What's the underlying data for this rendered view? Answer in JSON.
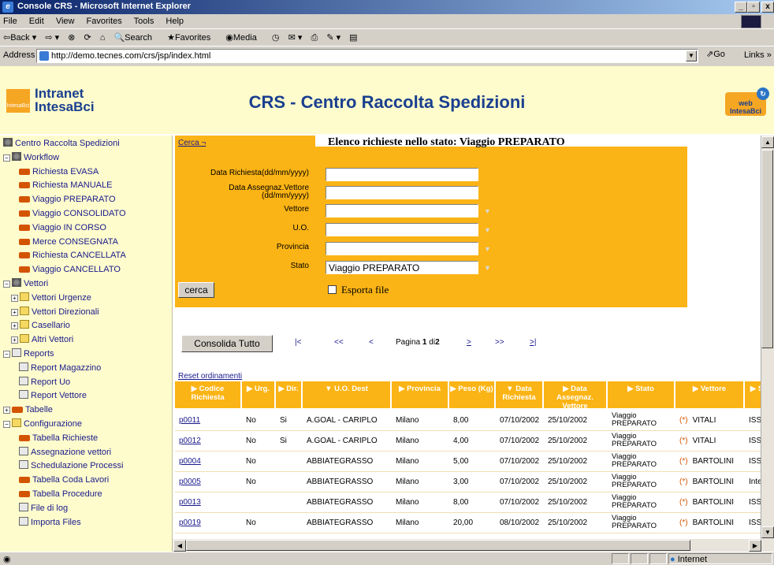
{
  "window": {
    "title": "Console CRS - Microsoft Internet Explorer"
  },
  "menu": [
    "File",
    "Edit",
    "View",
    "Favorites",
    "Tools",
    "Help"
  ],
  "toolbar": {
    "back": "⇦Back ▾",
    "forward": "⇨ ▾",
    "stop": "⊗",
    "refresh": "⟳",
    "home": "⌂",
    "search": "Search",
    "favorites": "Favorites",
    "media": "Media",
    "history": "◷",
    "mail": "✉ ▾",
    "print": "⎙",
    "edit": "✎ ▾",
    "discuss": "▤"
  },
  "address": {
    "label": "Address",
    "url": "http://demo.tecnes.com/crs/jsp/index.html",
    "go": "Go",
    "links": "Links"
  },
  "banner": {
    "logo_small": "IntesaBci",
    "logo_line1": "Intranet",
    "logo_line2": "IntesaBci",
    "title": "CRS - Centro Raccolta Spedizioni",
    "web_logo": "web IntesaBci"
  },
  "tree": [
    {
      "label": "Centro Raccolta Spedizioni",
      "indent": 0,
      "icon": "gear",
      "exp": ""
    },
    {
      "label": "Workflow",
      "indent": 0,
      "icon": "gear",
      "exp": "−"
    },
    {
      "label": "Richiesta EVASA",
      "indent": 2,
      "icon": "small",
      "exp": ""
    },
    {
      "label": "Richiesta MANUALE",
      "indent": 2,
      "icon": "small",
      "exp": ""
    },
    {
      "label": "Viaggio PREPARATO",
      "indent": 2,
      "icon": "small",
      "exp": ""
    },
    {
      "label": "Viaggio CONSOLIDATO",
      "indent": 2,
      "icon": "small",
      "exp": ""
    },
    {
      "label": "Viaggio IN CORSO",
      "indent": 2,
      "icon": "small",
      "exp": ""
    },
    {
      "label": "Merce CONSEGNATA",
      "indent": 2,
      "icon": "small",
      "exp": ""
    },
    {
      "label": "Richiesta CANCELLATA",
      "indent": 2,
      "icon": "small",
      "exp": ""
    },
    {
      "label": "Viaggio CANCELLATO",
      "indent": 2,
      "icon": "small",
      "exp": ""
    },
    {
      "label": "Vettori",
      "indent": 0,
      "icon": "gear",
      "exp": "−"
    },
    {
      "label": "Vettori Urgenze",
      "indent": 1,
      "icon": "folder",
      "exp": "+"
    },
    {
      "label": "Vettori Direzionali",
      "indent": 1,
      "icon": "folder",
      "exp": "+"
    },
    {
      "label": "Casellario",
      "indent": 1,
      "icon": "folder",
      "exp": "+"
    },
    {
      "label": "Altri Vettori",
      "indent": 1,
      "icon": "folder",
      "exp": "+"
    },
    {
      "label": "Reports",
      "indent": 0,
      "icon": "doc",
      "exp": "−"
    },
    {
      "label": "Report Magazzino",
      "indent": 2,
      "icon": "doc",
      "exp": ""
    },
    {
      "label": "Report Uo",
      "indent": 2,
      "icon": "doc",
      "exp": ""
    },
    {
      "label": "Report Vettore",
      "indent": 2,
      "icon": "doc",
      "exp": ""
    },
    {
      "label": "Tabelle",
      "indent": 0,
      "icon": "small",
      "exp": "+"
    },
    {
      "label": "Configurazione",
      "indent": 0,
      "icon": "folder",
      "exp": "−"
    },
    {
      "label": "Tabella Richieste",
      "indent": 2,
      "icon": "small",
      "exp": ""
    },
    {
      "label": "Assegnazione vettori",
      "indent": 2,
      "icon": "doc",
      "exp": ""
    },
    {
      "label": "Schedulazione Processi",
      "indent": 2,
      "icon": "doc",
      "exp": ""
    },
    {
      "label": "Tabella Coda Lavori",
      "indent": 2,
      "icon": "small",
      "exp": ""
    },
    {
      "label": "Tabella Procedure",
      "indent": 2,
      "icon": "small",
      "exp": ""
    },
    {
      "label": "File di log",
      "indent": 2,
      "icon": "doc",
      "exp": ""
    },
    {
      "label": "Importa Files",
      "indent": 2,
      "icon": "doc",
      "exp": ""
    }
  ],
  "search": {
    "link": "Cerca ¬",
    "list_title": "Elenco richieste nello stato: Viaggio PREPARATO",
    "fields": [
      {
        "label": "Data Richiesta(dd/mm/yyyy)",
        "value": ""
      },
      {
        "label": "Data Assegnaz.Vettore\n(dd/mm/yyyy)",
        "value": ""
      },
      {
        "label": "Vettore",
        "value": ""
      },
      {
        "label": "U.O.",
        "value": ""
      },
      {
        "label": "Provincia",
        "value": ""
      },
      {
        "label": "Stato",
        "value": "Viaggio PREPARATO"
      }
    ],
    "button": "cerca",
    "export_label": "Esporta file"
  },
  "pager": {
    "consolida": "Consolida Tutto",
    "first": "|<",
    "prev_page": "<<",
    "prev": "<",
    "page_text": "Pagina",
    "page_num": "1",
    "page_of": "di",
    "page_total": "2",
    "next": ">",
    "next_page": ">>",
    "last": ">|"
  },
  "table": {
    "reset": "Reset ordinamenti",
    "headers": [
      "▶ Codice Richiesta",
      "▶ Urg.",
      "▶ Dir.",
      "▼ U.O. Dest",
      "▶ Provincia",
      "▶ Peso (Kg)",
      "▼ Data Richiesta",
      "▶ Data Assegnaz. Vettore",
      "▶ Stato",
      "▶ Vettore",
      "▶ S"
    ],
    "rows": [
      [
        "p0011",
        "No",
        "Si",
        "A.GOAL - CARIPLO",
        "Milano",
        "8,00",
        "07/10/2002",
        "25/10/2002",
        "Viaggio PREPARATO",
        "VITALI",
        "ISS"
      ],
      [
        "p0012",
        "No",
        "Si",
        "A.GOAL - CARIPLO",
        "Milano",
        "4,00",
        "07/10/2002",
        "25/10/2002",
        "Viaggio PREPARATO",
        "VITALI",
        "ISS"
      ],
      [
        "p0004",
        "No",
        "",
        "ABBIATEGRASSO",
        "Milano",
        "5,00",
        "07/10/2002",
        "25/10/2002",
        "Viaggio PREPARATO",
        "BARTOLINI",
        "ISS"
      ],
      [
        "p0005",
        "No",
        "",
        "ABBIATEGRASSO",
        "Milano",
        "3,00",
        "07/10/2002",
        "25/10/2002",
        "Viaggio PREPARATO",
        "BARTOLINI",
        "Inte"
      ],
      [
        "p0013",
        "",
        "",
        "ABBIATEGRASSO",
        "Milano",
        "8,00",
        "07/10/2002",
        "25/10/2002",
        "Viaggio PREPARATO",
        "BARTOLINI",
        "ISS"
      ],
      [
        "p0019",
        "No",
        "",
        "ABBIATEGRASSO",
        "Milano",
        "20,00",
        "08/10/2002",
        "25/10/2002",
        "Viaggio PREPARATO",
        "BARTOLINI",
        "ISS"
      ]
    ],
    "vettore_prefix": "(*)"
  },
  "status": {
    "zone": "Internet"
  },
  "colors": {
    "banner": "#fefccc",
    "orange": "#fbb415",
    "title_blue": "#1a3f8f"
  }
}
